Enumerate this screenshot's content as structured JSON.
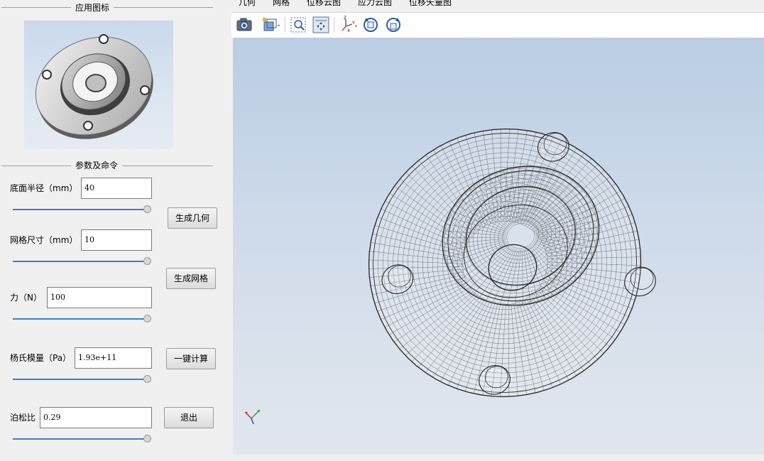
{
  "icon_group": {
    "title": "应用图标"
  },
  "params_group": {
    "title": "参数及命令"
  },
  "params": {
    "radius": {
      "label": "底面半径（mm）",
      "value": "40"
    },
    "mesh": {
      "label": "网格尺寸（mm）",
      "value": "10"
    },
    "force": {
      "label": "力（N）",
      "value": "100"
    },
    "young": {
      "label": "杨氏模量（Pa）",
      "value": "1.93e+11"
    },
    "poisson": {
      "label": "泊松比",
      "value": "0.29"
    }
  },
  "buttons": {
    "gen_geom": "生成几何",
    "gen_mesh": "生成网格",
    "compute": "一键计算",
    "exit": "退出"
  },
  "tabs": [
    "几何",
    "网格",
    "位移云图",
    "应力云图",
    "位移矢量图"
  ],
  "toolbar_icons": [
    "camera-icon",
    "display-mode-icon",
    "zoom-box-icon",
    "fit-all-icon",
    "axes-icon",
    "rotate-left-icon",
    "rotate-right-icon"
  ],
  "colors": {
    "slider": "#3b7fc6",
    "viewport_top": "#b9cde4",
    "viewport_bottom": "#e2e7ee"
  }
}
